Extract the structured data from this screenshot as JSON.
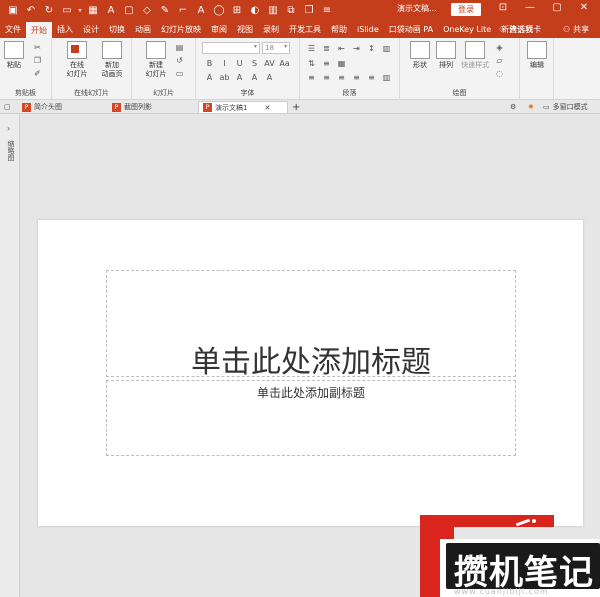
{
  "titlebar": {
    "doc_title": "演示文稿...",
    "login_label": "登录",
    "quick_access": [
      "save-icon",
      "undo-icon",
      "redo-icon",
      "start-icon",
      "dropdown",
      "table-icon",
      "textbox-icon",
      "slide-icon",
      "shapes-icon",
      "pen-icon",
      "format-painter-icon",
      "ab-icon",
      "circle-icon",
      "more-icon",
      "fill-icon",
      "chart-icon",
      "arrange-icon",
      "customize-icon"
    ]
  },
  "tabs": [
    "文件",
    "开始",
    "插入",
    "设计",
    "切换",
    "动画",
    "幻灯片放映",
    "审阅",
    "视图",
    "录制",
    "开发工具",
    "帮助",
    "iSlide",
    "口袋动画 PA",
    "OneKey Lite",
    "新建选项卡"
  ],
  "active_tab": "开始",
  "tell_me": "告诉我",
  "share": "共享",
  "ribbon": {
    "groups": {
      "clipboard": {
        "label": "剪贴板",
        "paste": "粘贴"
      },
      "online_slides": {
        "label": "在线幻灯片",
        "online": "在线\n幻灯片",
        "new_anim": "新加\n动画页"
      },
      "slides": {
        "label": "幻灯片",
        "new_slide": "新建\n幻灯片"
      },
      "font": {
        "label": "字体",
        "size": "18"
      },
      "paragraph": {
        "label": "段落"
      },
      "drawing": {
        "label": "绘图",
        "shape": "形状",
        "arrange": "排列",
        "quick_style": "快速样式"
      },
      "editing": {
        "label": "",
        "edit": "编辑"
      }
    }
  },
  "doc_tabs": [
    {
      "name": "简介头图"
    },
    {
      "name": "截图列影"
    },
    {
      "name": "演示文稿1"
    }
  ],
  "multi_window": "多窗口模式",
  "side_label": "缩略图",
  "slide": {
    "title_placeholder": "单击此处添加标题",
    "subtitle_placeholder": "单击此处添加副标题"
  },
  "watermark": {
    "text": "攒机笔记",
    "url": "www.cuanjibiji.com"
  }
}
